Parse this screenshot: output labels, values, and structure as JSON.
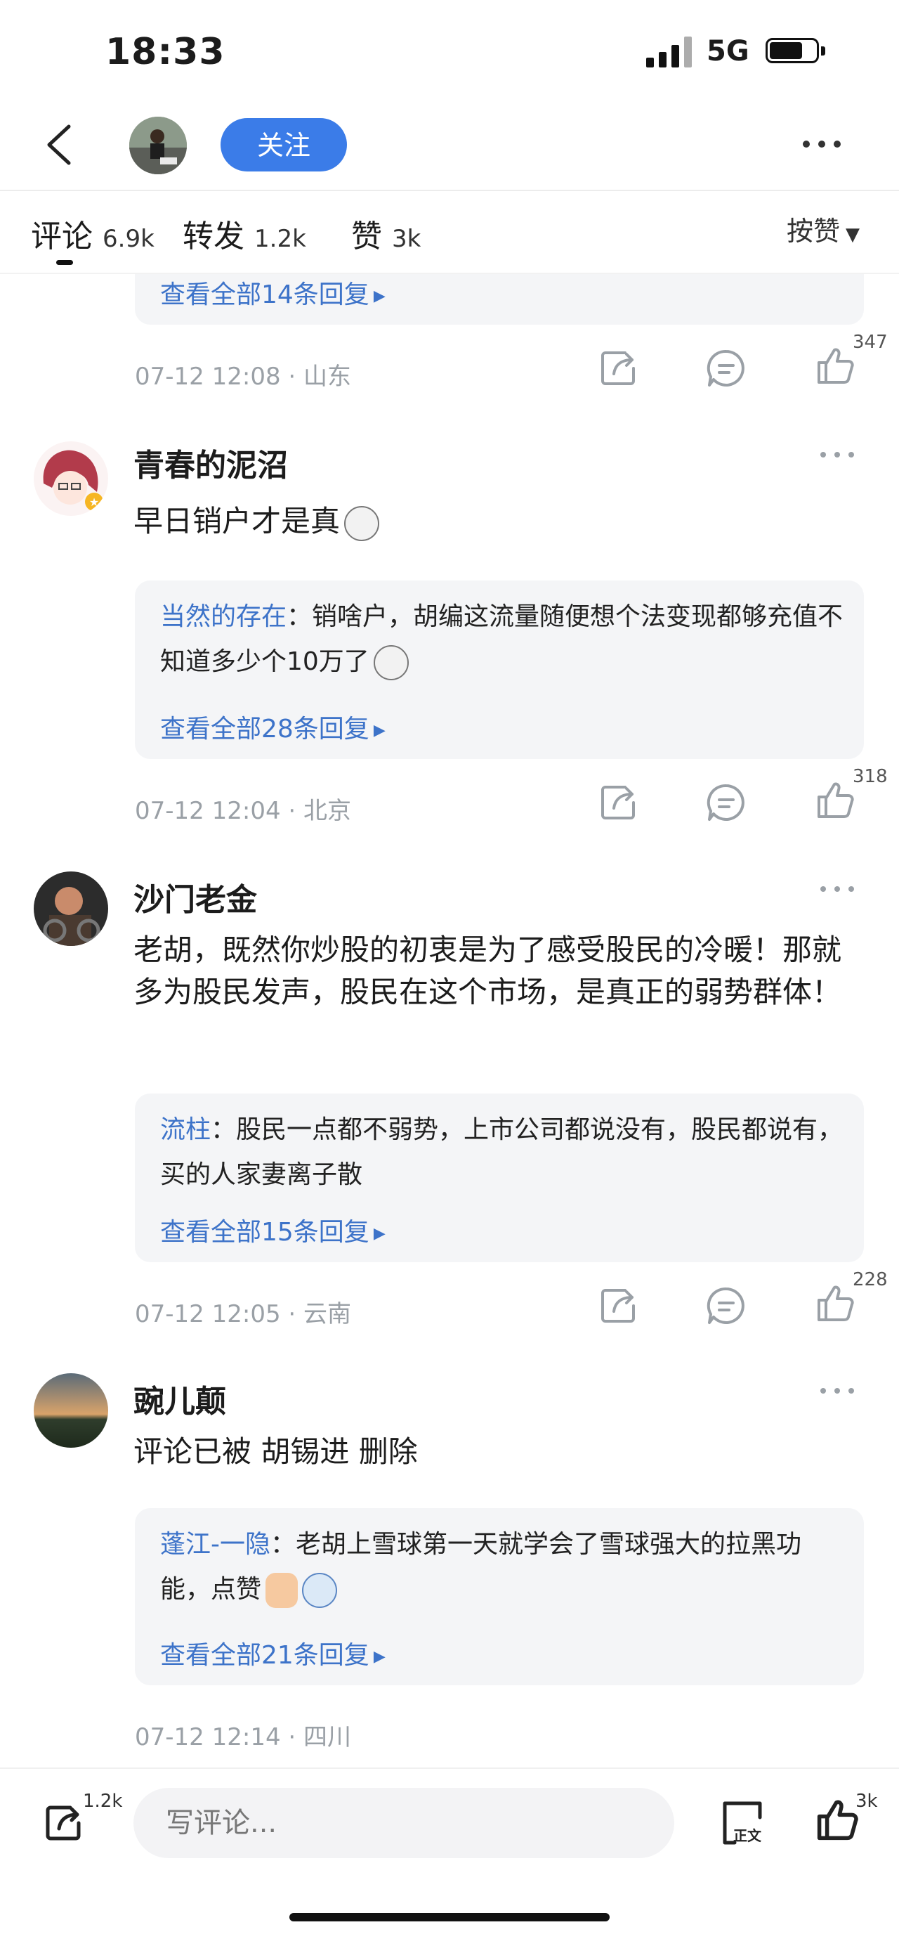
{
  "status_bar": {
    "time": "18:33",
    "network": "5G"
  },
  "nav": {
    "follow_label": "关注"
  },
  "tabs": [
    {
      "label": "评论",
      "count": "6.9k"
    },
    {
      "label": "转发",
      "count": "1.2k"
    },
    {
      "label": "赞",
      "count": "3k"
    }
  ],
  "sort": {
    "label": "按赞"
  },
  "top_partial": {
    "view_all": "查看全部14条回复",
    "meta": "07-12 12:08 · 山东",
    "likes": "347"
  },
  "comments": [
    {
      "name": "青春的泥沼",
      "text": "早日销户才是真",
      "reply_user": "当然的存在",
      "reply_text": "：销啥户，胡编这流量随便想个法变现都够充值不知道多少个10万了",
      "view_all": "查看全部28条回复",
      "meta": "07-12 12:04 · 北京",
      "likes": "318"
    },
    {
      "name": "沙门老金",
      "text": "老胡，既然你炒股的初衷是为了感受股民的冷暖！那就多为股民发声，股民在这个市场，是真正的弱势群体！",
      "reply_user": "流柱",
      "reply_text": "：股民一点都不弱势，上市公司都说没有，股民都说有，买的人家妻离子散",
      "view_all": "查看全部15条回复",
      "meta": "07-12 12:05 · 云南",
      "likes": "228"
    },
    {
      "name": "豌儿颠",
      "text": "评论已被 胡锡进 删除",
      "reply_user": "蓬江-一隐",
      "reply_text": "：老胡上雪球第一天就学会了雪球强大的拉黑功能，点赞",
      "view_all": "查看全部21条回复",
      "meta": "07-12 12:14 · 四川"
    }
  ],
  "bottom": {
    "share_count": "1.2k",
    "input_placeholder": "写评论...",
    "text_badge": "正文",
    "like_count": "3k"
  },
  "icons": {
    "back": "chevron-left-icon",
    "more": "more-dots-icon",
    "share": "share-icon",
    "comment": "comment-icon",
    "like": "thumb-up-icon"
  },
  "colors": {
    "accent": "#3b7ce8",
    "reply_user": "#3d73c9",
    "reply_bg": "#f4f5f7",
    "meta_gray": "#9aa0a6"
  }
}
